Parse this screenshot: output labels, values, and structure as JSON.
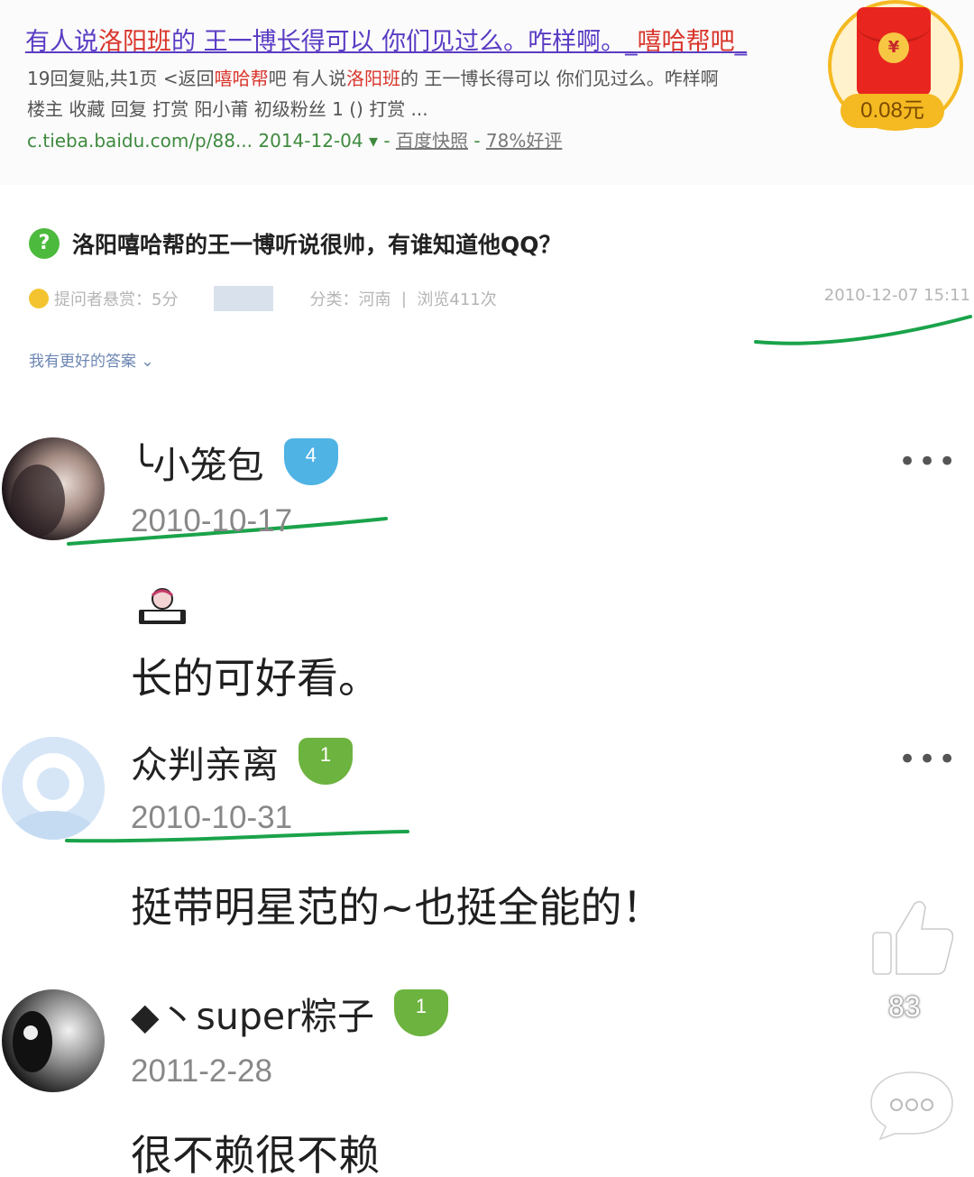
{
  "search_result": {
    "title_parts": [
      "有人说",
      "洛阳班",
      "的 王一博长得可以 你们见过么。咋样啊。_",
      "嘻哈帮吧",
      "_"
    ],
    "snippet_line1_parts": [
      "19回复贴,共1页 <返回",
      "嘻哈帮",
      "吧 有人说",
      "洛阳班",
      "的 王一博长得可以 你们见过么。咋样啊"
    ],
    "snippet_line2": "楼主 收藏 回复 打赏 阳小莆 初级粉丝 1 () 打赏 ...",
    "url": "c.tieba.baidu.com/p/88...",
    "date": "2014-12-04",
    "cache_link": "百度快照",
    "rating": "78%好评"
  },
  "red_envelope": {
    "coin_symbol": "¥",
    "amount": "0.08元"
  },
  "question": {
    "icon": "?",
    "text": "洛阳嘻哈帮的王一博听说很帅，有谁知道他QQ？",
    "reward": "提问者悬赏：5分",
    "category": "分类：河南",
    "views": "浏览411次",
    "time": "2010-12-07 15:11",
    "better_answer": "我有更好的答案 ⌄"
  },
  "answers": [
    {
      "name": "╰小笼包",
      "level": "4",
      "date": "2010-10-17",
      "more": "•••",
      "content": "长的可好看。"
    },
    {
      "name": "众判亲离",
      "level": "1",
      "date": "2010-10-31",
      "more": "•••",
      "content": "挺带明星范的~也挺全能的！"
    },
    {
      "name": "◆丶super粽子",
      "level": "1",
      "date": "2011-2-28",
      "content": "很不赖很不赖"
    }
  ],
  "floating": {
    "like_icon": "thumbs-up-icon",
    "like_count": "83",
    "comment_icon": "comment-bubble-icon"
  },
  "colors": {
    "level_blue": "#4fb3e4",
    "level_green": "#6db33f",
    "underline_green": "#1aa34a",
    "title_purple": "#5a3cc4",
    "keyword_red": "#d9352b"
  }
}
